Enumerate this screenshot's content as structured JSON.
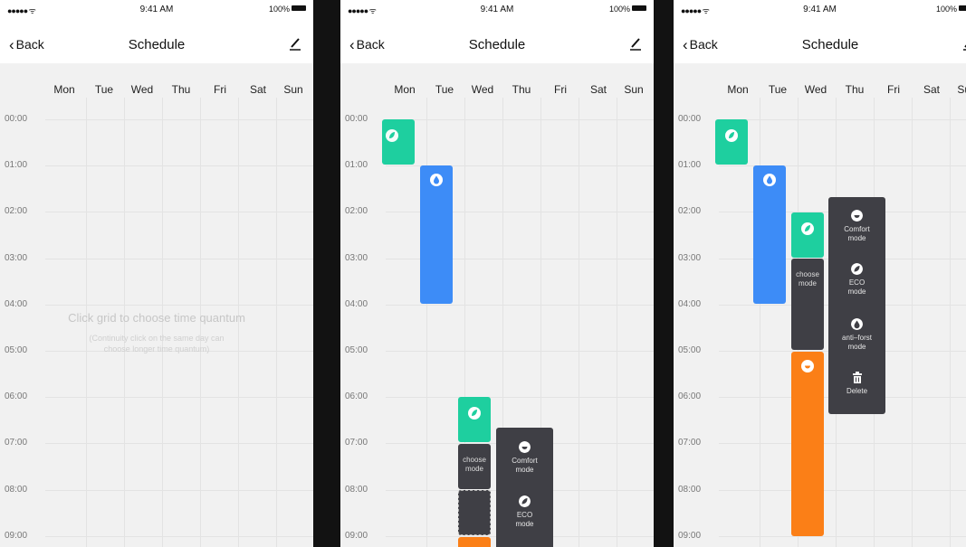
{
  "status_bar": {
    "signal": "●●●●● ᯤ",
    "time": "9:41 AM",
    "battery": "100%"
  },
  "nav": {
    "back_label": "Back",
    "title": "Schedule",
    "edit_icon": "pencil-icon"
  },
  "days": [
    "Mon",
    "Tue",
    "Wed",
    "Thu",
    "Fri",
    "Sat",
    "Sun"
  ],
  "hours": [
    "00:00",
    "01:00",
    "02:00",
    "03:00",
    "04:00",
    "05:00",
    "06:00",
    "07:00",
    "08:00",
    "09:00"
  ],
  "hint": {
    "main": "Click grid to choose time quantum",
    "line1": "(Continuity click on the same day can",
    "line2": "choose longer time quantum)"
  },
  "screen2": {
    "choose_mode": [
      "choose",
      "mode"
    ],
    "menu": [
      {
        "icon": "comfort-icon",
        "label1": "Comfort",
        "label2": "mode"
      },
      {
        "icon": "eco-leaf-icon",
        "label1": "ECO",
        "label2": "mode"
      }
    ]
  },
  "screen3": {
    "choose_mode": [
      "choose",
      "mode"
    ],
    "menu": [
      {
        "icon": "comfort-icon",
        "label1": "Comfort",
        "label2": "mode"
      },
      {
        "icon": "eco-leaf-icon",
        "label1": "ECO",
        "label2": "mode"
      },
      {
        "icon": "drop-icon",
        "label1": "anti–forst",
        "label2": "mode"
      },
      {
        "icon": "trash-icon",
        "label1": "Delete",
        "label2": ""
      }
    ]
  },
  "colors": {
    "eco": "#1ecf9f",
    "anti_frost": "#3d8cf7",
    "comfort": "#fb7f17",
    "menu": "#3f3f45"
  }
}
